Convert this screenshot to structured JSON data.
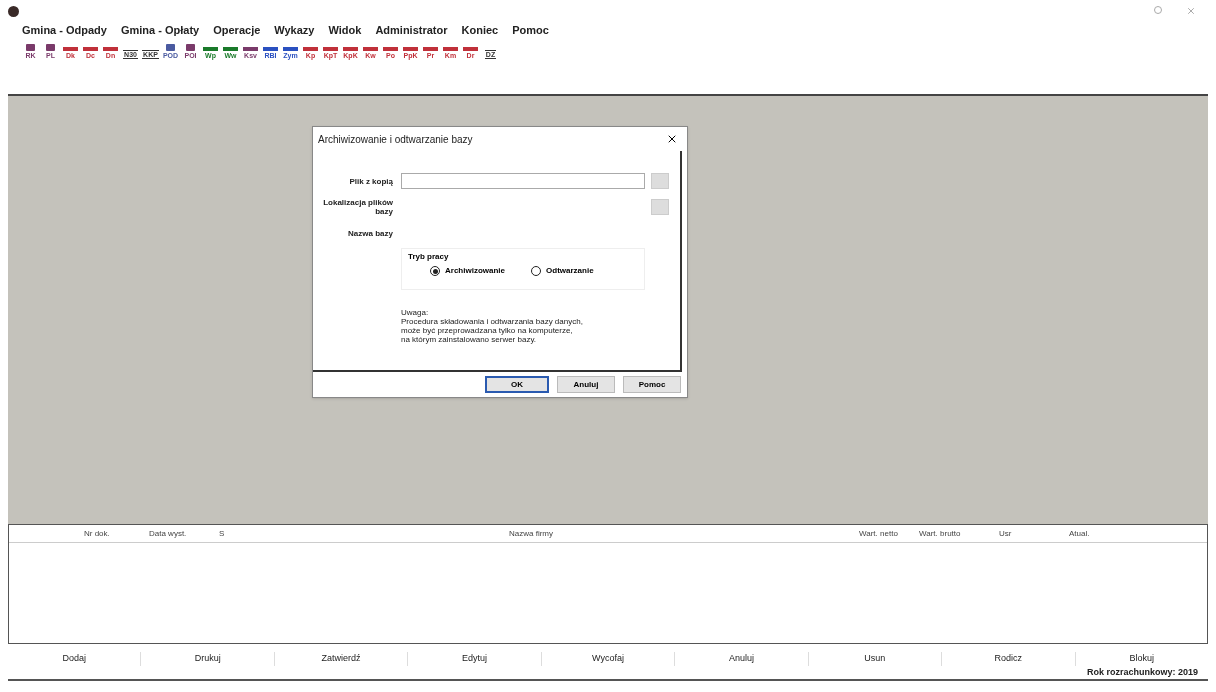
{
  "menu": [
    "Gmina - Odpady",
    "Gmina - Opłaty",
    "Operacje",
    "Wykazy",
    "Widok",
    "Administrator",
    "Koniec",
    "Pomoc"
  ],
  "toolbar": [
    {
      "label": "RK",
      "color": "#7a3a6a",
      "kind": "glyph"
    },
    {
      "label": "PL",
      "color": "#7a3a6a",
      "kind": "glyph"
    },
    {
      "label": "Dk",
      "color": "#c0303a",
      "kind": "bar"
    },
    {
      "label": "Dc",
      "color": "#c0303a",
      "kind": "bar"
    },
    {
      "label": "Dn",
      "color": "#c0303a",
      "kind": "bar"
    },
    {
      "label": "N30",
      "color": "#333333",
      "kind": "box"
    },
    {
      "label": "KKP",
      "color": "#333333",
      "kind": "box"
    },
    {
      "label": "POD",
      "color": "#4a5aa0",
      "kind": "glyph"
    },
    {
      "label": "POI",
      "color": "#7a3a6a",
      "kind": "glyph"
    },
    {
      "label": "Wp",
      "color": "#1a7a2a",
      "kind": "bar"
    },
    {
      "label": "Ww",
      "color": "#1a7a2a",
      "kind": "bar"
    },
    {
      "label": "Ksv",
      "color": "#7a3a6a",
      "kind": "bar"
    },
    {
      "label": "RBI",
      "color": "#2a50c0",
      "kind": "bar"
    },
    {
      "label": "Zym",
      "color": "#2a50c0",
      "kind": "bar"
    },
    {
      "label": "Kp",
      "color": "#c0303a",
      "kind": "bar"
    },
    {
      "label": "KpT",
      "color": "#c0303a",
      "kind": "bar"
    },
    {
      "label": "KpK",
      "color": "#c0303a",
      "kind": "bar"
    },
    {
      "label": "Kw",
      "color": "#c0303a",
      "kind": "bar"
    },
    {
      "label": "Po",
      "color": "#c0303a",
      "kind": "bar"
    },
    {
      "label": "PpK",
      "color": "#c0303a",
      "kind": "bar"
    },
    {
      "label": "Pr",
      "color": "#c0303a",
      "kind": "bar"
    },
    {
      "label": "Km",
      "color": "#c0303a",
      "kind": "bar"
    },
    {
      "label": "Dr",
      "color": "#c0303a",
      "kind": "bar"
    },
    {
      "label": "DZ",
      "color": "#333333",
      "kind": "box"
    }
  ],
  "dialog": {
    "title": "Archiwizowanie i odtwarzanie bazy",
    "fields": [
      {
        "label": "Plik z kopią",
        "kind": "input"
      },
      {
        "label": "Lokalizacja plików bazy",
        "kind": "browse"
      },
      {
        "label": "Nazwa bazy",
        "kind": "text"
      }
    ],
    "mode": {
      "label": "Tryb pracy",
      "options": [
        {
          "label": "Archiwizowanie",
          "selected": true
        },
        {
          "label": "Odtwarzanie",
          "selected": false
        }
      ]
    },
    "note_title": "Uwaga:",
    "note_lines": [
      "Procedura składowania i odtwarzania bazy danych,",
      "może być przeprowadzana tylko na komputerze,",
      "na którym zainstalowano serwer bazy."
    ],
    "buttons": [
      {
        "label": "OK",
        "selected": true
      },
      {
        "label": "Anuluj",
        "selected": false
      },
      {
        "label": "Pomoc",
        "selected": false
      }
    ]
  },
  "table": {
    "columns": [
      "Nr dok.",
      "Data wyst.",
      "S",
      "Nazwa firmy",
      "Wart. netto",
      "Wart. brutto",
      "Usr",
      "Atual."
    ]
  },
  "actions": [
    "Dodaj",
    "Drukuj",
    "Zatwierdź",
    "Edytuj",
    "Wycofaj",
    "Anuluj",
    "Usun",
    "Rodicz",
    "Blokuj"
  ],
  "status_bar": "Rok rozrachunkowy: 2019"
}
